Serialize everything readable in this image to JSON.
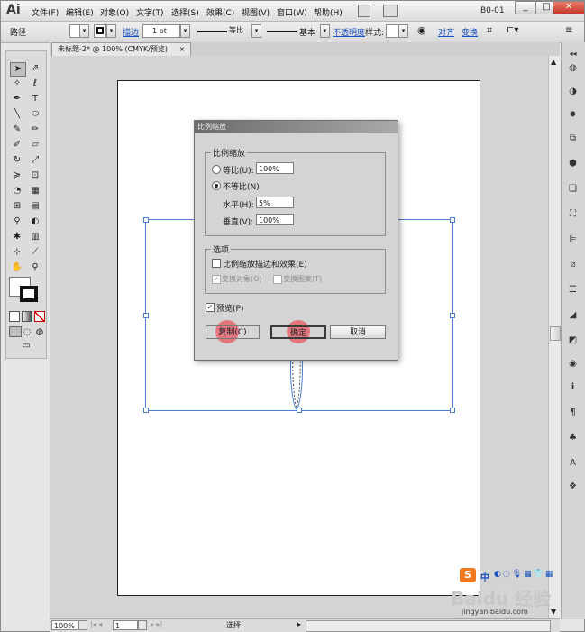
{
  "app": {
    "logo": "Ai",
    "workspace": "B0-01"
  },
  "menu": [
    "文件(F)",
    "编辑(E)",
    "对象(O)",
    "文字(T)",
    "选择(S)",
    "效果(C)",
    "视图(V)",
    "窗口(W)",
    "帮助(H)"
  ],
  "window_buttons": [
    "_",
    "□",
    "✕"
  ],
  "control_bar": {
    "selection_label": "路径",
    "stroke_link": "描边",
    "stroke_weight": "1 pt",
    "profile_label": "等比",
    "brush_label": "基本",
    "opacity_link": "不透明度",
    "style_label": "样式:",
    "align_link": "对齐",
    "transform_link": "变换"
  },
  "document_tab": {
    "title": "未标题-2* @ 100% (CMYK/预览)",
    "close": "×"
  },
  "status_bar": {
    "zoom": "100%",
    "page": "1",
    "tool_status": "选择"
  },
  "dialog": {
    "title": "比例缩放",
    "scale_group_title": "比例缩放",
    "uniform_label": "等比(U):",
    "uniform_value": "100%",
    "nonuniform_label": "不等比(N)",
    "horizontal_label": "水平(H):",
    "horizontal_value": "5%",
    "vertical_label": "垂直(V):",
    "vertical_value": "100%",
    "options_title": "选项",
    "scale_strokes_label": "比例缩放描边和效果(E)",
    "transform_objects_label": "变换对象(O)",
    "transform_patterns_label": "变换图案(T)",
    "preview_label": "预览(P)",
    "copy_button": "复制(C)",
    "ok_button": "确定",
    "cancel_button": "取消",
    "selected_mode": "nonuniform",
    "preview_checked": true
  },
  "watermark": {
    "brand": "Baidu 经验",
    "url": "jingyan.baidu.com",
    "ime": "中"
  },
  "colors": {
    "selection_blue": "#4f7dd6",
    "highlight_red": "#e85864",
    "link_blue": "#1a4fbf"
  }
}
